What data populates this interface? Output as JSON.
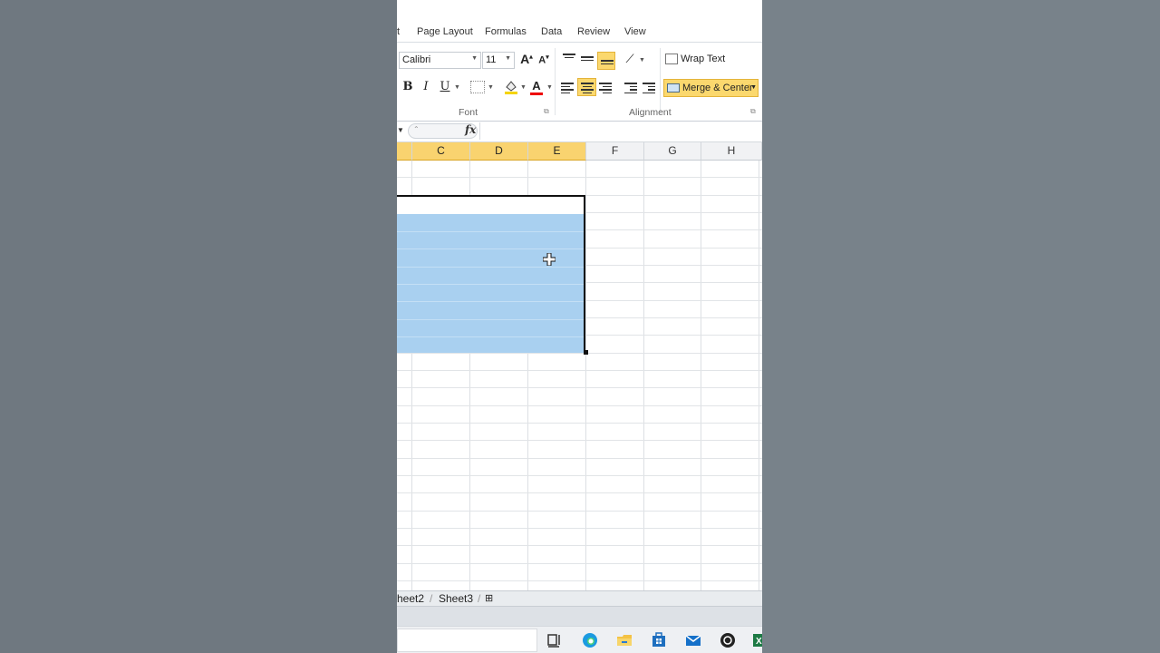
{
  "menu_tabs": [
    "t",
    "Page Layout",
    "Formulas",
    "Data",
    "Review",
    "View"
  ],
  "font_group": {
    "label": "Font",
    "font_name": "Calibri",
    "font_size": "11",
    "bold": "B",
    "italic": "I",
    "underline": "U",
    "font_color_letter": "A",
    "grow_letter": "A",
    "shrink_letter": "A"
  },
  "alignment_group": {
    "label": "Alignment",
    "wrap_text": "Wrap Text",
    "merge_center": "Merge & Center"
  },
  "formula_bar": {
    "fx": "fx",
    "value": ""
  },
  "columns": [
    {
      "label": "C",
      "selected": true
    },
    {
      "label": "D",
      "selected": true
    },
    {
      "label": "E",
      "selected": true
    },
    {
      "label": "F",
      "selected": false
    },
    {
      "label": "G",
      "selected": false
    },
    {
      "label": "H",
      "selected": false
    }
  ],
  "sheet_tabs": [
    "heet2",
    "Sheet3"
  ],
  "colors": {
    "selected_header": "#f9d36f",
    "selection_fill": "#a9d0f0",
    "active_button": "#fbd86e"
  }
}
